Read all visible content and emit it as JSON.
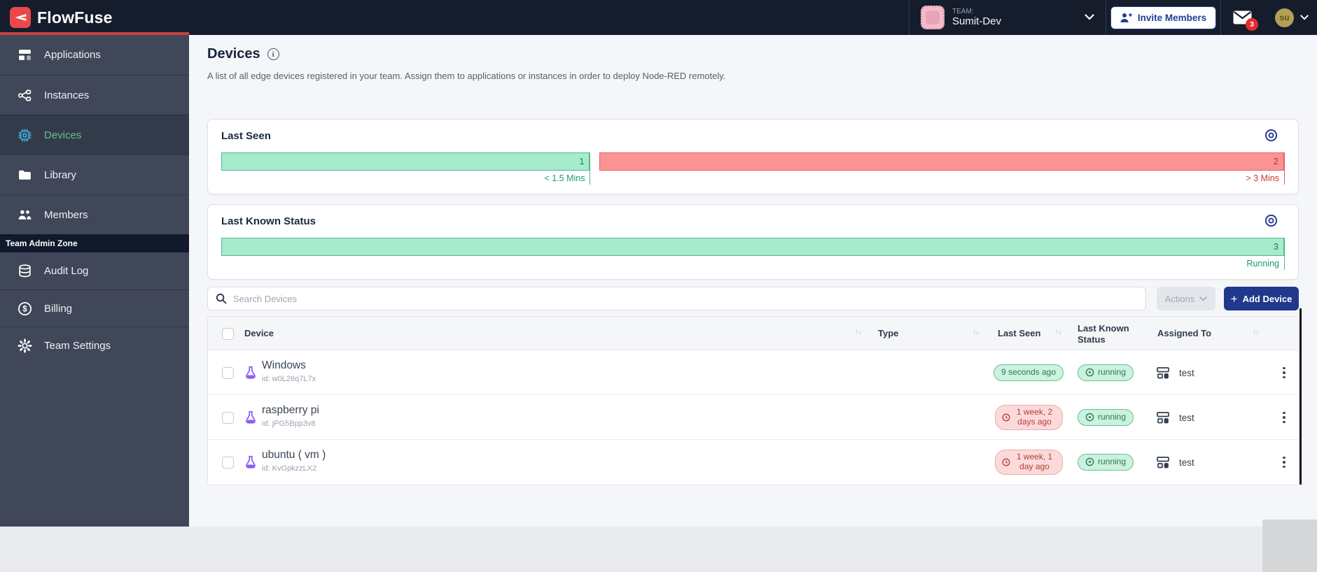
{
  "nav": {
    "brand": "FlowFuse",
    "team_label": "TEAM:",
    "team_name": "Sumit-Dev",
    "invite_label": "Invite Members",
    "inbox_badge": "3",
    "avatar_initials": "su"
  },
  "sidebar": {
    "items": [
      {
        "label": "Applications"
      },
      {
        "label": "Instances"
      },
      {
        "label": "Devices"
      },
      {
        "label": "Library"
      },
      {
        "label": "Members"
      }
    ],
    "admin_section_label": "Team Admin Zone",
    "admin_items": [
      {
        "label": "Audit Log"
      },
      {
        "label": "Billing"
      },
      {
        "label": "Team Settings"
      }
    ]
  },
  "page": {
    "title": "Devices",
    "description": "A list of all edge devices registered in your team. Assign them to applications or instances in order to deploy Node-RED remotely."
  },
  "cards": {
    "last_seen": {
      "title": "Last Seen",
      "segments": [
        {
          "value": 1,
          "label": "< 1.5 Mins",
          "tone": "ok"
        },
        {
          "value": 2,
          "label": "> 3 Mins",
          "tone": "warn"
        }
      ]
    },
    "last_known_status": {
      "title": "Last Known Status",
      "segments": [
        {
          "value": 3,
          "label": "Running",
          "tone": "ok"
        }
      ]
    }
  },
  "chart_data": [
    {
      "type": "bar",
      "title": "Last Seen",
      "categories": [
        "< 1.5 Mins",
        "> 3 Mins"
      ],
      "values": [
        1,
        2
      ]
    },
    {
      "type": "bar",
      "title": "Last Known Status",
      "categories": [
        "Running"
      ],
      "values": [
        3
      ]
    }
  ],
  "toolbar": {
    "search_placeholder": "Search Devices",
    "actions_label": "Actions",
    "add_device_plus": "+",
    "add_device_label": "Add Device"
  },
  "table": {
    "columns": [
      "Device",
      "Type",
      "Last Seen",
      "Last Known Status",
      "Assigned To"
    ],
    "rows": [
      {
        "name": "Windows",
        "id": "id: w0L26q7L7x",
        "last_seen": "9 seconds ago",
        "last_seen_tone": "ok",
        "status": "running",
        "assigned_to": "test"
      },
      {
        "name": "raspberry pi",
        "id": "id: jPG5Bpp3v8",
        "last_seen": "1 week, 2 days ago",
        "last_seen_tone": "warn",
        "status": "running",
        "assigned_to": "test"
      },
      {
        "name": "ubuntu ( vm )",
        "id": "id: KvGpkzzLX2",
        "last_seen": "1 week, 1 day ago",
        "last_seen_tone": "warn",
        "status": "running",
        "assigned_to": "test"
      }
    ]
  },
  "colors": {
    "accent_red": "#e9494a",
    "navbar": "#151d2c",
    "primary_navy": "#20398c",
    "ok_green": "#5ec397",
    "warn_red": "#e4605f",
    "active_item_blue": "#3fa7d8",
    "active_item_green": "#5fc28e"
  }
}
